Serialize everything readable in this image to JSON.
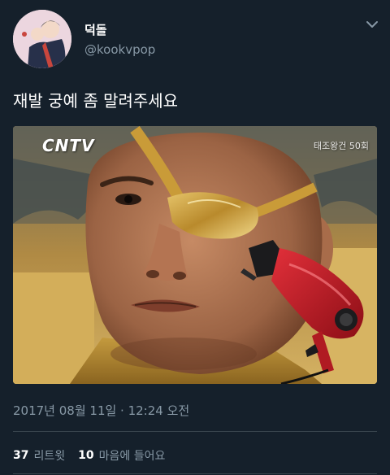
{
  "tweet": {
    "display_name": "덕돌",
    "handle": "@kookvpop",
    "text": "재발 궁예 좀 말려주세요",
    "timestamp": "2017년 08월 11일 · 12:24 오전",
    "retweet_count": "37",
    "retweet_label": "리트윗",
    "like_count": "10",
    "like_label": "마음에 들어요"
  },
  "media": {
    "watermark_left": "CNTV",
    "watermark_right": "태조왕건 50회"
  },
  "icons": {
    "menu": "chevron-down-icon"
  },
  "colors": {
    "background": "#15202b",
    "secondary_text": "#8899a6",
    "divider": "#38444d"
  }
}
